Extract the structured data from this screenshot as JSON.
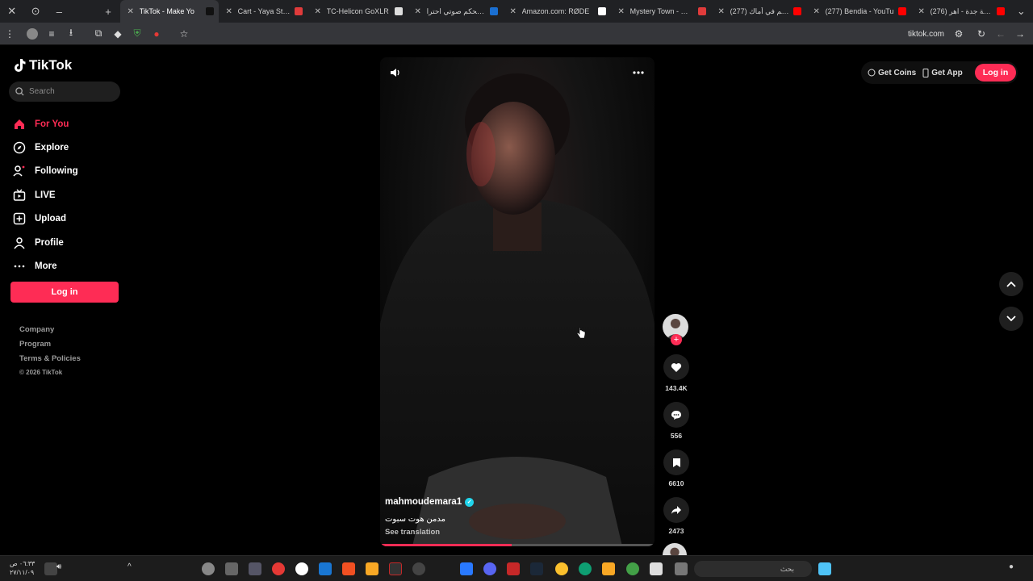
{
  "browser": {
    "tabs": [
      {
        "title": "TikTok - Make Yo",
        "color": "#111111",
        "active": true
      },
      {
        "title": "Cart - Yaya Station",
        "color": "#e03b3b",
        "active": false
      },
      {
        "title": "TC-Helicon GoXLR",
        "color": "#dddddd",
        "active": false
      },
      {
        "title": "جهاز تحكم صوتي احترا",
        "color": "#1a6fd1",
        "active": false
      },
      {
        "title": "Amazon.com: RØDE",
        "color": "#ffffff",
        "active": false
      },
      {
        "title": "Mystery Town - MT S",
        "color": "#e03b3b",
        "active": false
      },
      {
        "title": "(277) رميتاهم في أماك",
        "color": "#ff0000",
        "active": false
      },
      {
        "title": "(277) Bendia - YouTu",
        "color": "#ff0000",
        "active": false
      },
      {
        "title": "(276) ايقونة جدة - اهر",
        "color": "#ff0000",
        "active": false
      }
    ],
    "url": "tiktok.com"
  },
  "tiktok": {
    "logo_text": "TikTok",
    "search_placeholder": "Search",
    "nav": [
      {
        "label": "For You",
        "icon": "home-icon",
        "active": true
      },
      {
        "label": "Explore",
        "icon": "compass-icon",
        "active": false
      },
      {
        "label": "Following",
        "icon": "following-icon",
        "active": false
      },
      {
        "label": "LIVE",
        "icon": "live-icon",
        "active": false
      },
      {
        "label": "Upload",
        "icon": "upload-icon",
        "active": false
      },
      {
        "label": "Profile",
        "icon": "profile-icon",
        "active": false
      },
      {
        "label": "More",
        "icon": "more-icon",
        "active": false
      }
    ],
    "login_label": "Log in",
    "footer": [
      "Company",
      "Program",
      "Terms & Policies",
      "© 2026 TikTok"
    ],
    "top": {
      "coins": "Get Coins",
      "app": "Get App",
      "login": "Log in"
    },
    "video": {
      "username": "mahmoudemara1",
      "description": "مدمن هوت سبوت",
      "see_translation": "See translation",
      "progress_percent": 48
    },
    "actions": {
      "likes": "143.4K",
      "comments": "556",
      "saves": "6610",
      "shares": "2473"
    },
    "accent": "#fe2c55"
  },
  "taskbar": {
    "search_placeholder": "بحث",
    "time": "٠٦:٣٣ ص",
    "date": "٢٧/١١/٠٩"
  }
}
